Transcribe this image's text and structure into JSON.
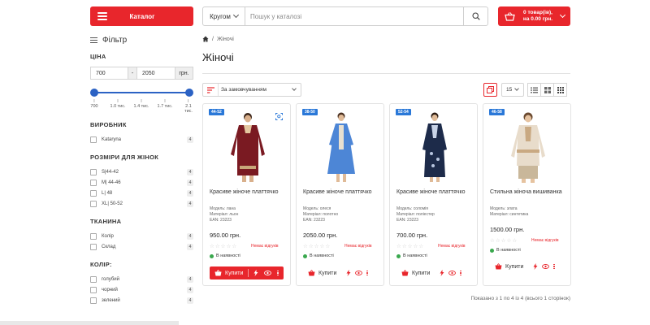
{
  "header": {
    "catalog_label": "Каталог",
    "search_scope": "Кругом",
    "search_placeholder": "Пошук у каталозі",
    "cart_line1": "0 товар(ів),",
    "cart_line2": "на 0.00 грн."
  },
  "sidebar": {
    "filter_title": "Фільтр",
    "price": {
      "title": "ЦІНА",
      "min": "700",
      "dash": "-",
      "max": "2050",
      "currency": "грн.",
      "ticks": [
        "700",
        "1.0 тис.",
        "1.4 тис.",
        "1.7 тис.",
        "2.1 тис."
      ]
    },
    "manufacturer": {
      "title": "ВИРОБНИК",
      "items": [
        {
          "label": "Kataryna",
          "count": "4"
        }
      ]
    },
    "sizes": {
      "title": "РОЗМІРИ ДЛЯ ЖІНОК",
      "items": [
        {
          "label": "S|44-42",
          "count": "4"
        },
        {
          "label": "M| 44-46",
          "count": "4"
        },
        {
          "label": "L| 48",
          "count": "4"
        },
        {
          "label": "XL| 50-52",
          "count": "4"
        }
      ]
    },
    "fabric": {
      "title": "ТКАНИНА",
      "items": [
        {
          "label": "Колір",
          "count": "4"
        },
        {
          "label": "Склад",
          "count": "4"
        }
      ]
    },
    "color": {
      "title": "КОЛІР:",
      "items": [
        {
          "label": "голубий",
          "count": "4"
        },
        {
          "label": "чорний",
          "count": "4"
        },
        {
          "label": "зелений",
          "count": "4"
        }
      ]
    }
  },
  "main": {
    "breadcrumb_current": "Жіночі",
    "breadcrumb_sep": "/",
    "title": "Жіночі",
    "sort_label": "За замовчуванням",
    "per_page": "15",
    "paging_text": "Показано з 1 по 4 із 4 (всього 1 сторінок)"
  },
  "products": [
    {
      "badge": "44-52",
      "name": "Красиве жіноче платтячко",
      "model": "Модель: лана",
      "material": "Матеріал: льон",
      "ean": "EAN: 23223",
      "price": "950.00 грн.",
      "noreviews": "Немає відгуків",
      "stock": "В наявності",
      "buy": "Купити"
    },
    {
      "badge": "38-50",
      "name": "Красиве жіноче платтячко",
      "model": "Модель: олеся",
      "material": "Матеріал: полотно",
      "ean": "EAN: 23223",
      "price": "2050.00 грн.",
      "noreviews": "Немає відгуків",
      "stock": "В наявності",
      "buy": "Купити"
    },
    {
      "badge": "52-54",
      "name": "Красиве жіноче платтячко",
      "model": "Модель: соломія",
      "material": "Матеріал: поліестер",
      "ean": "EAN: 23223",
      "price": "700.00 грн.",
      "noreviews": "Немає відгуків",
      "stock": "В наявності",
      "buy": "Купити"
    },
    {
      "badge": "46-58",
      "name": "Стильна жіноча вишиванка",
      "model": "Модель: злата",
      "material": "Матеріал: синтетика",
      "ean": "",
      "price": "1500.00 грн.",
      "noreviews": "Немає відгуків",
      "stock": "В наявності",
      "buy": "Купити"
    }
  ],
  "colors": {
    "accent": "#e8262c",
    "slider": "#2b62c4",
    "badge": "#2a78d8",
    "in_stock": "#3aa84e"
  },
  "icons": [
    "menu-icon",
    "search-icon",
    "cart-icon",
    "filter-icon",
    "home-icon",
    "sort-icon",
    "grid-icon",
    "list-icon",
    "quick-view-icon",
    "bolt-icon",
    "eye-icon",
    "more-icon"
  ]
}
